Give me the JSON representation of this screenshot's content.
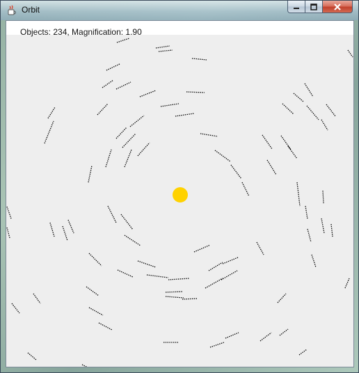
{
  "window": {
    "title": "Orbit",
    "icon": "java-coffee-cup-icon",
    "controls": {
      "minimize_icon": "minimize-icon",
      "maximize_icon": "maximize-icon",
      "close_icon": "close-icon"
    }
  },
  "status": {
    "text": "Objects: 234, Magnification: 1.90"
  },
  "simulation": {
    "sun_color": "#ffd200",
    "trail_color": "#000000",
    "background_color": "#eeeeee"
  }
}
